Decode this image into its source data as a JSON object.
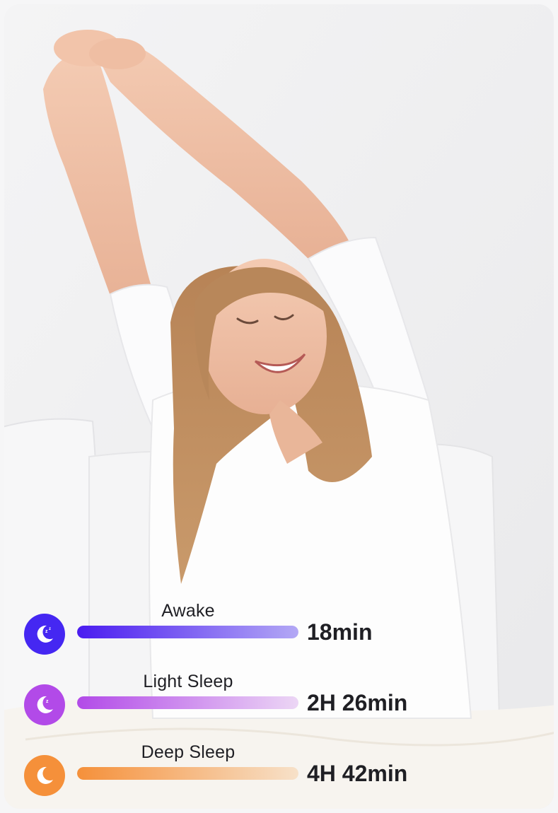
{
  "stats": [
    {
      "label": "Awake",
      "value": "18min",
      "icon": "moon-zzz-icon",
      "icon_color": "#4527f2",
      "bar_from": "#4a1cf0",
      "bar_to": "#b3a8f5",
      "level": 1.0
    },
    {
      "label": "Light Sleep",
      "value": "2H 26min",
      "icon": "moon-z-icon",
      "icon_color": "#b24ae8",
      "bar_from": "#b24ae8",
      "bar_to": "#ecd6f5",
      "level": 1.0
    },
    {
      "label": "Deep Sleep",
      "value": "4H 42min",
      "icon": "moon-icon",
      "icon_color": "#f5903a",
      "bar_from": "#f5903a",
      "bar_to": "#f7e1c9",
      "level": 1.0
    }
  ]
}
